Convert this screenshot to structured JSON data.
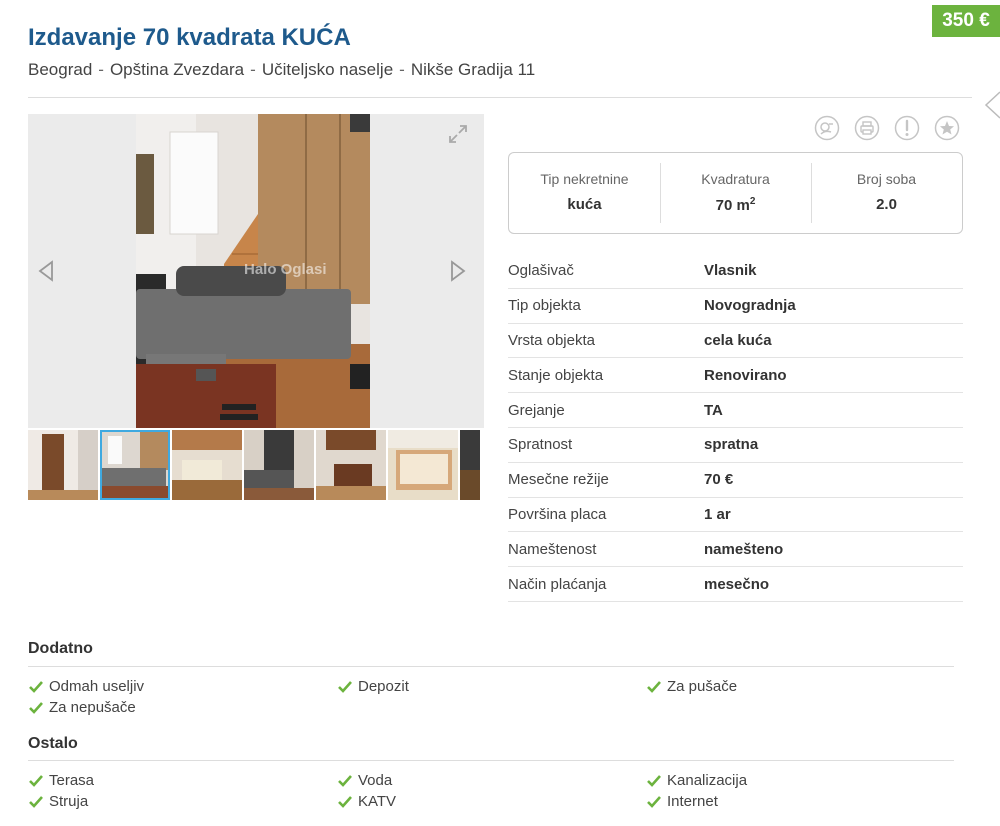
{
  "listing": {
    "price": "350 €",
    "title": "Izdavanje 70 kvadrata KUĆA",
    "location": [
      "Beograd",
      "Opština Zvezdara",
      "Učiteljsko naselje",
      "Nikše Gradija 11"
    ],
    "location_separator": "-"
  },
  "gallery": {
    "watermark": "Halo Oglasi",
    "thumbnail_count_visible": 7,
    "active_thumbnail": 2
  },
  "actions": [
    "share-icon",
    "print-icon",
    "report-icon",
    "favorite-icon"
  ],
  "summary": [
    {
      "label": "Tip nekretnine",
      "value": "kuća"
    },
    {
      "label": "Kvadratura",
      "value": "70 m",
      "sup": "2"
    },
    {
      "label": "Broj soba",
      "value": "2.0"
    }
  ],
  "details": [
    {
      "label": "Oglašivač",
      "value": "Vlasnik"
    },
    {
      "label": "Tip objekta",
      "value": "Novogradnja"
    },
    {
      "label": "Vrsta objekta",
      "value": "cela kuća"
    },
    {
      "label": "Stanje objekta",
      "value": "Renovirano"
    },
    {
      "label": "Grejanje",
      "value": "TA"
    },
    {
      "label": "Spratnost",
      "value": "spratna"
    },
    {
      "label": "Mesečne režije",
      "value": "70 €"
    },
    {
      "label": "Površina placa",
      "value": "1 ar"
    },
    {
      "label": "Nameštenost",
      "value": "namešteno"
    },
    {
      "label": "Način plaćanja",
      "value": "mesečno"
    }
  ],
  "dodatno": {
    "title": "Dodatno",
    "items": [
      "Odmah useljiv",
      "Depozit",
      "Za pušače",
      "Za nepušače"
    ]
  },
  "ostalo": {
    "title": "Ostalo",
    "items": [
      "Terasa",
      "Voda",
      "Kanalizacija",
      "Struja",
      "KATV",
      "Internet"
    ]
  },
  "colors": {
    "price_badge": "#6cb33e",
    "title": "#1e5a8c",
    "check": "#6cb33e",
    "active_thumb": "#3fa9e0"
  }
}
